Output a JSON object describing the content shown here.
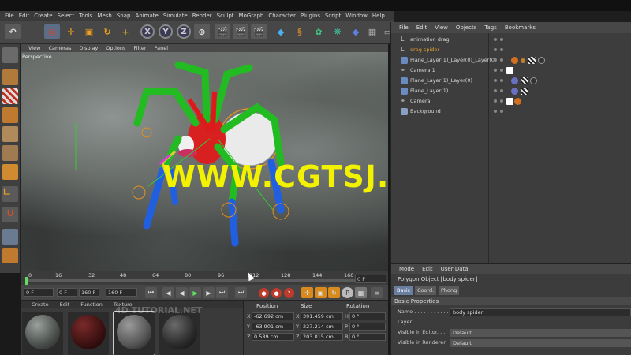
{
  "menubar": [
    "File",
    "Edit",
    "Create",
    "Select",
    "Tools",
    "Mesh",
    "Snap",
    "Animate",
    "Simulate",
    "Render",
    "Sculpt",
    "MoGraph",
    "Character",
    "Plugins",
    "Script",
    "Window",
    "Help"
  ],
  "toolbar": {
    "axis_x": "X",
    "axis_y": "Y",
    "axis_z": "Z"
  },
  "viewport": {
    "menu": [
      "View",
      "Cameras",
      "Display",
      "Options",
      "Filter",
      "Panel"
    ],
    "camera_label": "Perspective",
    "watermark": "WWW.CGTSJ.COM"
  },
  "timeline": {
    "ticks": [
      "0",
      "16",
      "32",
      "48",
      "64",
      "80",
      "96",
      "112",
      "128",
      "144",
      "160"
    ],
    "current_frame": "0 F"
  },
  "playbar": {
    "start": "0 F",
    "min": "0 F",
    "max": "160 F",
    "end": "160 F"
  },
  "material_manager": {
    "menu": [
      "Create",
      "Edit",
      "Function",
      "Texture"
    ],
    "watermark": "4D TUTORIAL.NET"
  },
  "coordinates": {
    "header_position": "Position",
    "header_size": "Size",
    "header_rotation": "Rotation",
    "rows": [
      {
        "axis": "X",
        "pos": "-62.692 cm",
        "size_axis": "X",
        "size": "391.459 cm",
        "rot_axis": "H",
        "rot": "0 °"
      },
      {
        "axis": "Y",
        "pos": "-63.901 cm",
        "size_axis": "Y",
        "size": "227.214 cm",
        "rot_axis": "P",
        "rot": "0 °"
      },
      {
        "axis": "Z",
        "pos": "0.589 cm",
        "size_axis": "Z",
        "size": "203.015 cm",
        "rot_axis": "B",
        "rot": "0 °"
      }
    ]
  },
  "object_manager": {
    "menu": [
      "File",
      "Edit",
      "View",
      "Objects",
      "Tags",
      "Bookmarks"
    ],
    "objects": [
      {
        "name": "animation drag",
        "color": "#d6d6d6"
      },
      {
        "name": "drag spider",
        "color": "#e0a030"
      },
      {
        "name": "Plane_Layer(1)_Layer(0)_Layer(0)",
        "color": "#d6d6d6"
      },
      {
        "name": "Camera.1",
        "color": "#d6d6d6"
      },
      {
        "name": "Plane_Layer(1)_Layer(0)",
        "color": "#d6d6d6"
      },
      {
        "name": "Plane_Layer(1)",
        "color": "#d6d6d6"
      },
      {
        "name": "Camera",
        "color": "#d6d6d6"
      },
      {
        "name": "Background",
        "color": "#d6d6d6"
      }
    ]
  },
  "attributes": {
    "menu": [
      "Mode",
      "Edit",
      "User Data"
    ],
    "title": "Polygon Object [body spider]",
    "tabs": [
      "Basic",
      "Coord.",
      "Phong"
    ],
    "section": "Basic Properties",
    "fields": [
      {
        "label": "Name . . . . . . . . . . .",
        "value": "body spider"
      },
      {
        "label": "Layer . . . . . . . . . . .",
        "value": ""
      },
      {
        "label": "Visible in Editor. . .",
        "value": "Default"
      },
      {
        "label": "Visible in Renderer",
        "value": "Default"
      }
    ]
  }
}
